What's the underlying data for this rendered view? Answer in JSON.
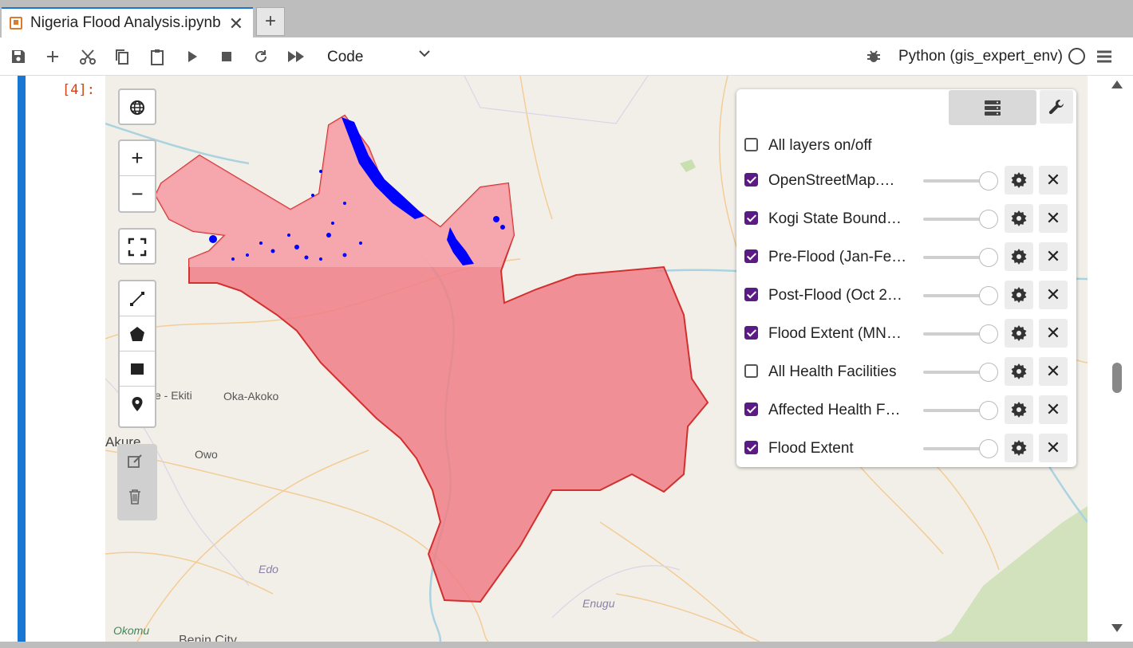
{
  "tab": {
    "title": "Nigeria Flood Analysis.ipynb",
    "close_glyph": "✕",
    "new_tab_glyph": "+"
  },
  "toolbar": {
    "cell_type": "Code",
    "kernel": "Python (gis_expert_env)"
  },
  "cell": {
    "prompt": "[4]:"
  },
  "map": {
    "place_labels": [
      "e - Ekiti",
      "Oka-Akoko",
      "Akure",
      "Owo",
      "Edo",
      "Enugu",
      "Okomu",
      "Benin City"
    ],
    "zoom_in": "+",
    "zoom_out": "−"
  },
  "layers_panel": {
    "all_toggle": {
      "label": "All layers on/off",
      "checked": false
    },
    "layers": [
      {
        "label": "OpenStreetMap.…",
        "checked": true
      },
      {
        "label": "Kogi State Bound…",
        "checked": true
      },
      {
        "label": "Pre-Flood (Jan-Fe…",
        "checked": true
      },
      {
        "label": "Post-Flood (Oct 2…",
        "checked": true
      },
      {
        "label": "Flood Extent (MN…",
        "checked": true
      },
      {
        "label": "All Health Facilities",
        "checked": false
      },
      {
        "label": "Affected Health F…",
        "checked": true
      },
      {
        "label": "Flood Extent",
        "checked": true
      }
    ]
  },
  "colors": {
    "accent": "#1976d2",
    "prompt": "#d84315",
    "checkbox": "#5b1a86",
    "flood_region": "#f07e86",
    "boundary": "#d32f2f",
    "flood_water": "#0000ff"
  }
}
